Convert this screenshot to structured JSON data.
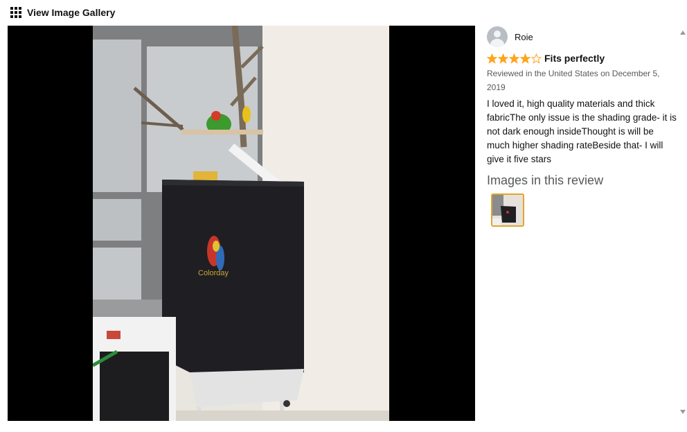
{
  "topbar": {
    "label": "View Image Gallery",
    "icon": "grid-icon"
  },
  "review": {
    "reviewer_name": "Roie",
    "rating": 4,
    "rating_max": 5,
    "star_color": "#ffa41c",
    "title": "Fits perfectly",
    "meta": "Reviewed in the United States on December 5, 2019",
    "body": "I loved it, high quality materials and thick fabricThe only issue is the shading grade- it is not dark enough insideThought is will be much higher shading rateBeside that- I will give it five stars"
  },
  "images_section": {
    "heading": "Images in this review",
    "thumb_border_color": "#e3a42a"
  },
  "photo": {
    "logo_text": "Colorday"
  }
}
